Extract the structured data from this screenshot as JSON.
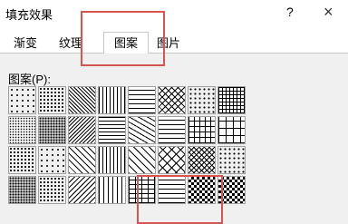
{
  "window": {
    "title": "填充效果",
    "help_label": "?",
    "close_label": "×"
  },
  "tabs": [
    {
      "label": "渐变",
      "selected": false
    },
    {
      "label": "纹理",
      "selected": false
    },
    {
      "label": "图案",
      "selected": true
    },
    {
      "label": "图片",
      "selected": false
    }
  ],
  "pattern_section": {
    "label": "图案(P):"
  },
  "patterns": [
    [
      "dots-sparse",
      "dots-medium",
      "diag-down-dense",
      "vertical-lines",
      "wave-h",
      "zigzag-h",
      "dots-grid",
      "grid-fine"
    ],
    [
      "dots-fine",
      "dots-dense",
      "diag-up-dense",
      "horizontal-lines",
      "diag-dash",
      "wave-h",
      "grid-medium",
      "grid-large"
    ],
    [
      "dots-medium",
      "dots-sparse",
      "diag-down",
      "vertical-lines",
      "diag-down-thin",
      "diamond",
      "grid-small",
      "dots-grid"
    ],
    [
      "dots-dense",
      "dots-medium",
      "diag-up",
      "vertical-dash",
      "brick",
      "wave-h",
      "checker",
      "checker"
    ]
  ],
  "colors": {
    "highlight": "#d9534f",
    "border": "#a0a0a0",
    "pattern_ink": "#000000"
  }
}
